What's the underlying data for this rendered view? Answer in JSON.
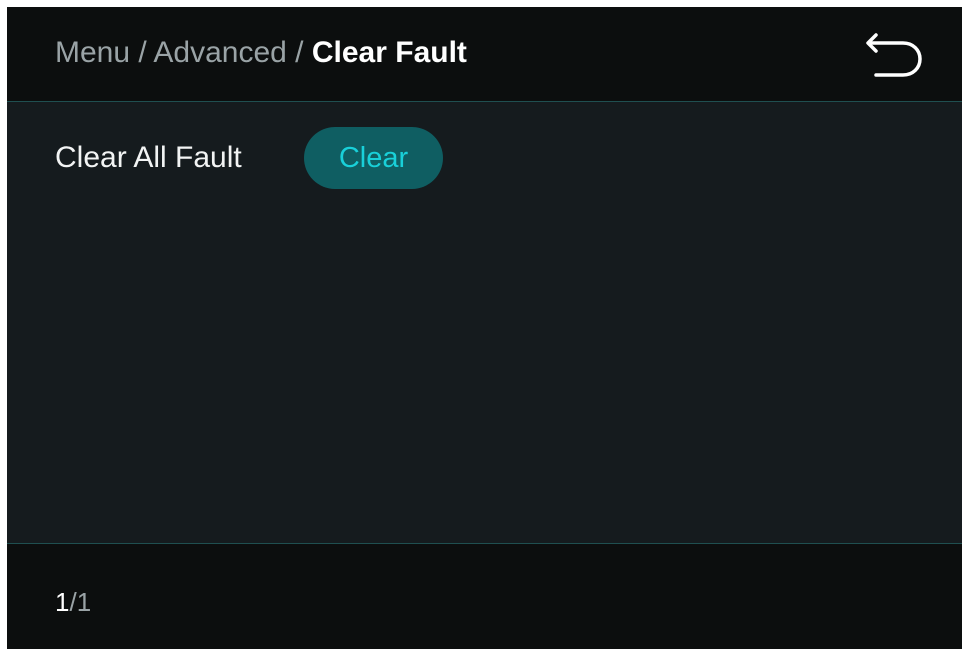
{
  "header": {
    "breadcrumb": [
      "Menu",
      "Advanced"
    ],
    "separator": " / ",
    "current": "Clear Fault",
    "back_icon": "back-arrow-icon"
  },
  "main": {
    "row_label": "Clear All Fault",
    "clear_button_label": "Clear"
  },
  "footer": {
    "page_current": "1",
    "page_separator": "/",
    "page_total": "1"
  },
  "colors": {
    "background": "#151b1e",
    "bar": "#0c0e0e",
    "accent": "#19d0d9",
    "button_fill": "#0f5e62",
    "divider": "#1f4f50"
  }
}
